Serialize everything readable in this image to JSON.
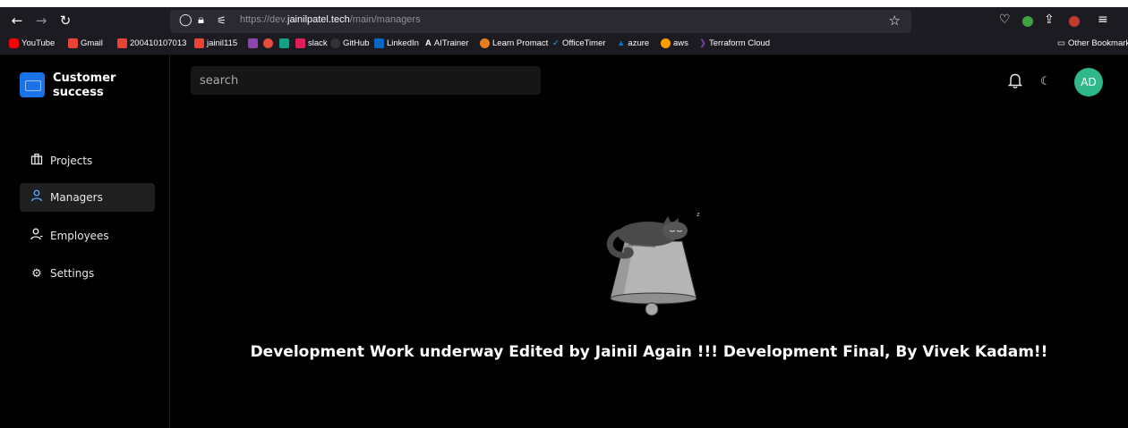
{
  "browser": {
    "url_prefix": "https://dev.",
    "url_host": "jainilpatel.tech",
    "url_path": "/main/managers",
    "bookmarks": [
      {
        "label": "YouTube",
        "color": "#ff0000"
      },
      {
        "label": "Gmail",
        "color": "#ea4335"
      },
      {
        "label": "200410107013",
        "color": "#ea4335"
      },
      {
        "label": "jainil115",
        "color": "#ea4335"
      },
      {
        "label": "",
        "color": "#8e44ad"
      },
      {
        "label": "",
        "color": "#e74c3c"
      },
      {
        "label": "",
        "color": "#16a085"
      },
      {
        "label": "slack",
        "color": "#e01e5a"
      },
      {
        "label": "GitHub",
        "color": "#333333"
      },
      {
        "label": "LinkedIn",
        "color": "#0a66c2"
      },
      {
        "label": "AITrainer",
        "color": "#ffffff"
      },
      {
        "label": "Learn Promact",
        "color": "#e67e22"
      },
      {
        "label": "OfficeTimer",
        "color": "#4aa3df"
      },
      {
        "label": "azure",
        "color": "#0078d4"
      },
      {
        "label": "aws",
        "color": "#ff9900"
      },
      {
        "label": "Terraform Cloud",
        "color": "#7b42bc"
      }
    ],
    "other_bookmarks": "Other Bookmarks"
  },
  "sidebar": {
    "brand": "Customer success",
    "items": [
      {
        "label": "Projects",
        "icon": "briefcase-icon"
      },
      {
        "label": "Managers",
        "icon": "user-icon",
        "active": true
      },
      {
        "label": "Employees",
        "icon": "user-plus-icon"
      },
      {
        "label": "Settings",
        "icon": "gear-icon"
      }
    ]
  },
  "header": {
    "search_placeholder": "search",
    "avatar": "AD"
  },
  "main": {
    "message": "Development Work underway Edited by Jainil Again !!! Development Final, By Vivek Kadam!!"
  },
  "colors": {
    "accent": "#1a73e8",
    "avatar_bg": "#2fb88b",
    "active_icon": "#5aa9ff"
  }
}
